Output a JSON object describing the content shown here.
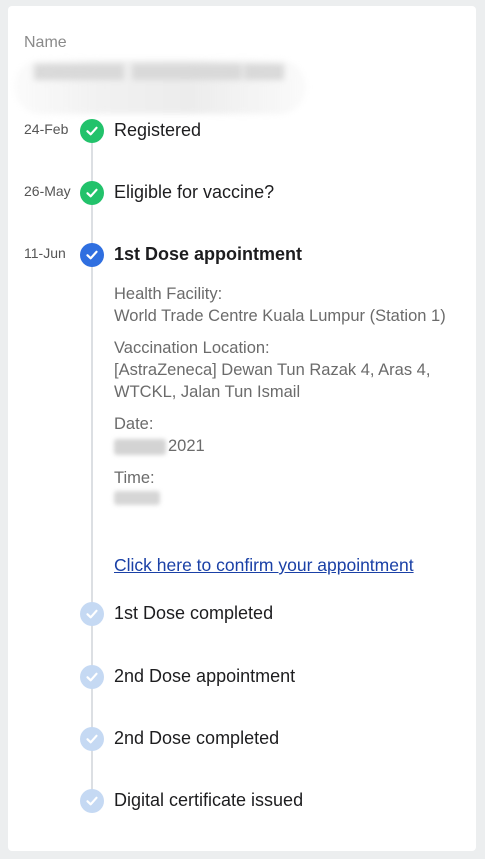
{
  "name_label": "Name",
  "steps": [
    {
      "date": "24-Feb",
      "label": "Registered",
      "status": "done",
      "color": "#22c26b"
    },
    {
      "date": "26-May",
      "label": "Eligible for vaccine?",
      "status": "done",
      "color": "#22c26b"
    },
    {
      "date": "11-Jun",
      "label": "1st Dose appointment",
      "status": "current",
      "color": "#2f6fe0"
    },
    {
      "date": "",
      "label": "1st Dose completed",
      "status": "pending",
      "color": "#c5d9f3"
    },
    {
      "date": "",
      "label": "2nd Dose appointment",
      "status": "pending",
      "color": "#c5d9f3"
    },
    {
      "date": "",
      "label": "2nd Dose completed",
      "status": "pending",
      "color": "#c5d9f3"
    },
    {
      "date": "",
      "label": "Digital certificate issued",
      "status": "pending",
      "color": "#c5d9f3"
    }
  ],
  "appointment": {
    "facility_label": "Health Facility:",
    "facility_value": "World Trade Centre Kuala Lumpur (Station 1)",
    "location_label": "Vaccination Location:",
    "location_value": "[AstraZeneca] Dewan Tun Razak 4, Aras 4, WTCKL, Jalan Tun Ismail",
    "date_label": "Date:",
    "date_year": "2021",
    "time_label": "Time:",
    "confirm_link": "Click here to confirm your appointment"
  },
  "icons": {
    "check": "check-icon"
  }
}
